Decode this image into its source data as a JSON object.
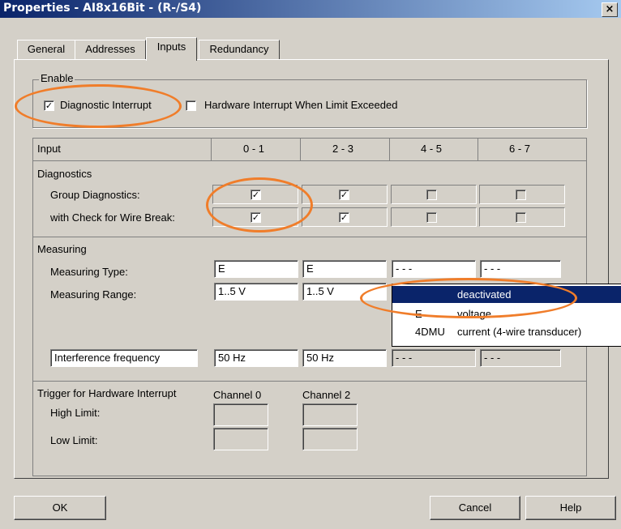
{
  "window": {
    "title": "Properties - AI8x16Bit - (R-/S4)",
    "close_glyph": "×"
  },
  "tabs": [
    {
      "label": "General"
    },
    {
      "label": "Addresses"
    },
    {
      "label": "Inputs"
    },
    {
      "label": "Redundancy"
    }
  ],
  "active_tab": "Inputs",
  "enable": {
    "group_label": "Enable",
    "diagnostic_interrupt": {
      "label": "Diagnostic Interrupt",
      "checked": true
    },
    "hardware_interrupt": {
      "label": "Hardware Interrupt When Limit Exceeded",
      "checked": false
    }
  },
  "table": {
    "input_header": "Input",
    "columns": [
      "0 - 1",
      "2 - 3",
      "4 - 5",
      "6 - 7"
    ],
    "diagnostics": {
      "section": "Diagnostics",
      "group_label": "Group Diagnostics:",
      "wire_label": "with Check for Wire Break:",
      "group_checked": [
        true,
        true,
        false,
        false
      ],
      "wire_checked": [
        true,
        true,
        false,
        false
      ]
    },
    "measuring": {
      "section": "Measuring",
      "type_label": "Measuring Type:",
      "range_label": "Measuring Range:",
      "types": [
        "E",
        "E",
        "- - -",
        "- - -"
      ],
      "ranges": [
        "1..5 V",
        "1..5 V"
      ],
      "interference_label": "Interference frequency",
      "interference": [
        "50 Hz",
        "50 Hz",
        "- - -",
        "- - -"
      ]
    },
    "trigger": {
      "section": "Trigger for Hardware Interrupt",
      "channel0": "Channel 0",
      "channel2": "Channel 2",
      "high_label": "High Limit:",
      "low_label": "Low Limit:"
    }
  },
  "dropdown": {
    "options": [
      {
        "code": "",
        "label": "deactivated",
        "selected": true
      },
      {
        "code": "E",
        "label": "voltage",
        "selected": false
      },
      {
        "code": "4DMU",
        "label": "current (4-wire transducer)",
        "selected": false
      }
    ]
  },
  "buttons": {
    "ok": "OK",
    "cancel": "Cancel",
    "help": "Help"
  },
  "colors": {
    "annotation": "#f07d2a",
    "selection": "#0a246a",
    "face": "#d4d0c8"
  }
}
